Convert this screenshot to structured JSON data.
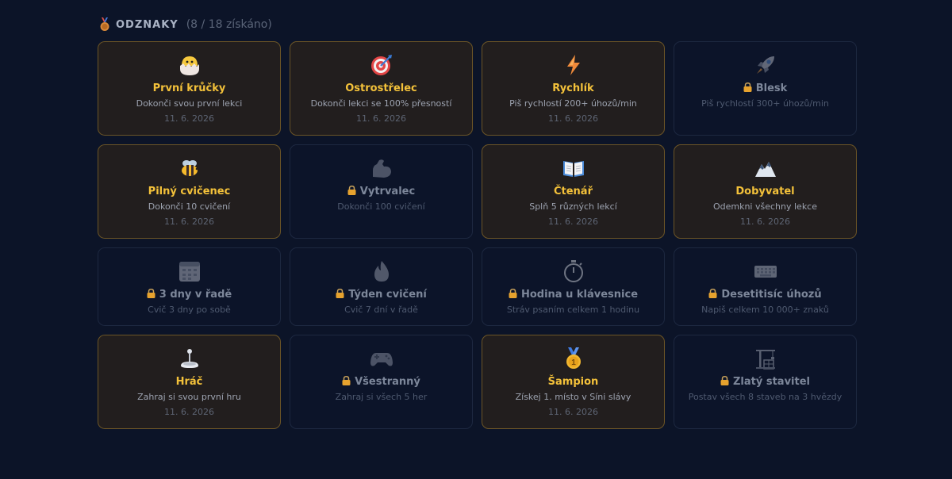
{
  "header": {
    "title": "ODZNAKY",
    "count": "(8 / 18 získáno)"
  },
  "colors": {
    "background": "#0c1428",
    "unlocked_title": "#f3c13a",
    "unlocked_border": "#6c5526",
    "locked_title": "#7d879a"
  },
  "badges": [
    {
      "title": "První krůčky",
      "desc": "Dokonči svou první lekci",
      "date": "11. 6. 2026",
      "unlocked": true,
      "icon": "hatching-chick-icon"
    },
    {
      "title": "Ostrostřelec",
      "desc": "Dokonči lekci se 100% přesností",
      "date": "11. 6. 2026",
      "unlocked": true,
      "icon": "target-icon"
    },
    {
      "title": "Rychlík",
      "desc": "Piš rychlostí 200+ úhozů/min",
      "date": "11. 6. 2026",
      "unlocked": true,
      "icon": "lightning-icon"
    },
    {
      "title": "Blesk",
      "desc": "Piš rychlostí 300+ úhozů/min",
      "date": "",
      "unlocked": false,
      "icon": "rocket-icon"
    },
    {
      "title": "Pilný cvičenec",
      "desc": "Dokonči 10 cvičení",
      "date": "11. 6. 2026",
      "unlocked": true,
      "icon": "bee-icon"
    },
    {
      "title": "Vytrvalec",
      "desc": "Dokonči 100 cvičení",
      "date": "",
      "unlocked": false,
      "icon": "flexed-biceps-icon"
    },
    {
      "title": "Čtenář",
      "desc": "Splň 5 různých lekcí",
      "date": "11. 6. 2026",
      "unlocked": true,
      "icon": "open-book-icon"
    },
    {
      "title": "Dobyvatel",
      "desc": "Odemkni všechny lekce",
      "date": "11. 6. 2026",
      "unlocked": true,
      "icon": "mountain-icon"
    },
    {
      "title": "3 dny v řadě",
      "desc": "Cvič 3 dny po sobě",
      "date": "",
      "unlocked": false,
      "icon": "calendar-icon"
    },
    {
      "title": "Týden cvičení",
      "desc": "Cvič 7 dní v řadě",
      "date": "",
      "unlocked": false,
      "icon": "flame-icon"
    },
    {
      "title": "Hodina u klávesnice",
      "desc": "Stráv psaním celkem 1 hodinu",
      "date": "",
      "unlocked": false,
      "icon": "stopwatch-icon"
    },
    {
      "title": "Desetitisíc úhozů",
      "desc": "Napiš celkem 10 000+ znaků",
      "date": "",
      "unlocked": false,
      "icon": "keyboard-icon"
    },
    {
      "title": "Hráč",
      "desc": "Zahraj si svou první hru",
      "date": "11. 6. 2026",
      "unlocked": true,
      "icon": "joystick-icon"
    },
    {
      "title": "Všestranný",
      "desc": "Zahraj si všech 5 her",
      "date": "",
      "unlocked": false,
      "icon": "game-controller-icon"
    },
    {
      "title": "Šampion",
      "desc": "Získej 1. místo v Síni slávy",
      "date": "11. 6. 2026",
      "unlocked": true,
      "icon": "first-place-medal-icon"
    },
    {
      "title": "Zlatý stavitel",
      "desc": "Postav všech 8 staveb na 3 hvězdy",
      "date": "",
      "unlocked": false,
      "icon": "construction-crane-icon"
    }
  ]
}
